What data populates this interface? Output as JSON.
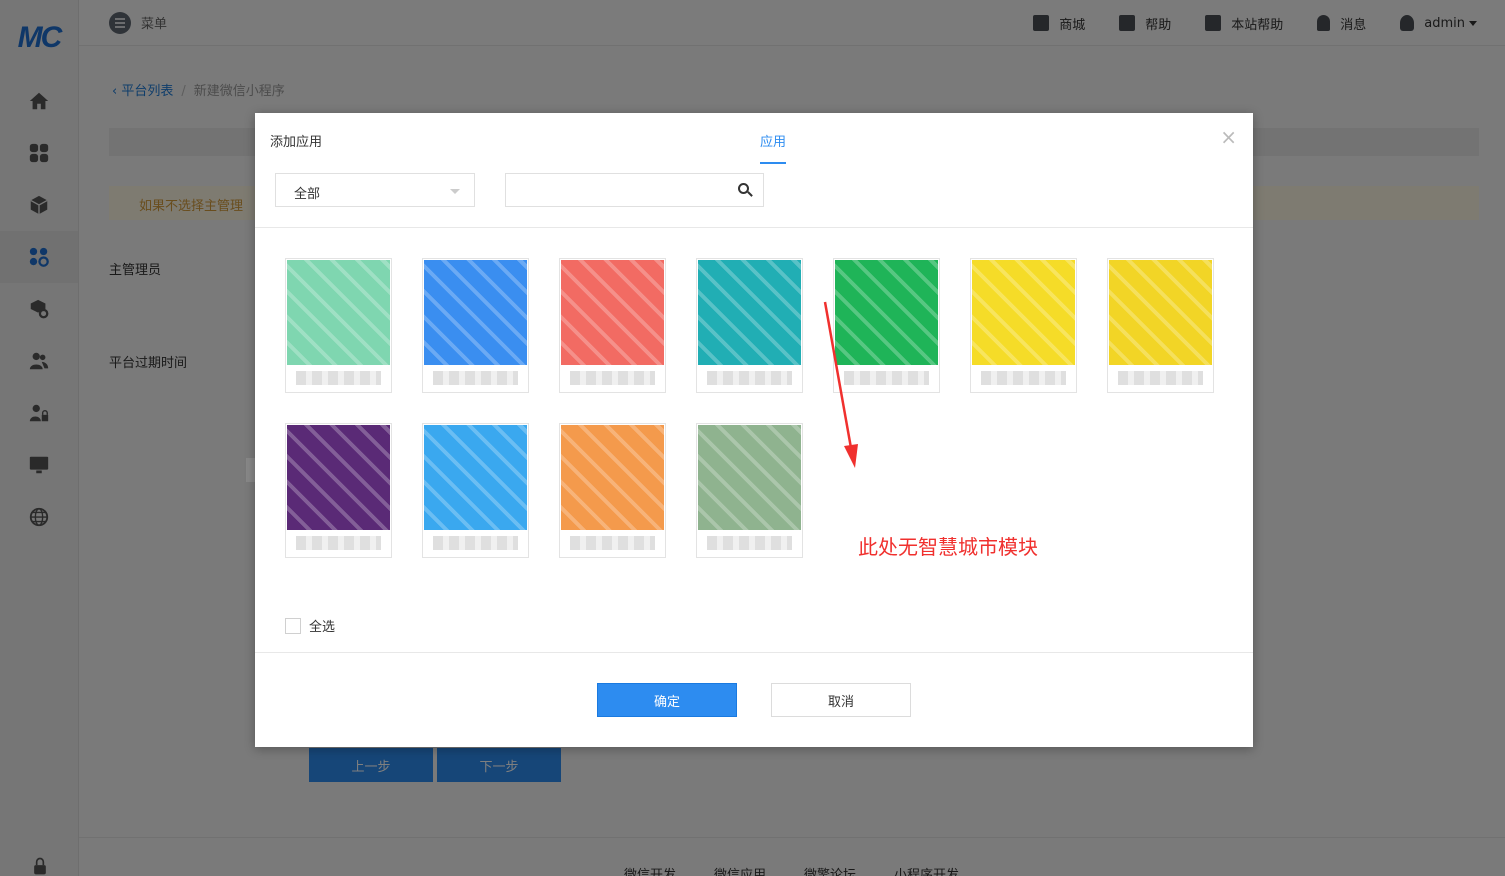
{
  "logo": "MC",
  "header": {
    "menu_label": "菜单",
    "links": [
      {
        "icon": "store-icon",
        "label": "商城"
      },
      {
        "icon": "help-icon",
        "label": "帮助"
      },
      {
        "icon": "site-help-icon",
        "label": "本站帮助"
      },
      {
        "icon": "bell-icon",
        "label": "消息"
      },
      {
        "icon": "user-icon",
        "label": "admin"
      }
    ]
  },
  "sidebar": {
    "items": [
      {
        "icon": "home-icon"
      },
      {
        "icon": "apps-grid-icon"
      },
      {
        "icon": "cube-icon"
      },
      {
        "icon": "apps-settings-icon",
        "active": true
      },
      {
        "icon": "package-settings-icon"
      },
      {
        "icon": "users-icon"
      },
      {
        "icon": "user-lock-icon"
      },
      {
        "icon": "monitor-icon"
      },
      {
        "icon": "globe-icon"
      }
    ]
  },
  "breadcrumb": {
    "back_label": "平台列表",
    "separator": "/",
    "current": "新建微信小程序"
  },
  "page": {
    "warning_text": "如果不选择主管理",
    "label_admin": "主管理员",
    "label_expire": "平台过期时间",
    "prev_step": "上一步",
    "next_step": "下一步"
  },
  "footer": {
    "links": [
      "微信开发",
      "微信应用",
      "微擎论坛",
      "小程序开发"
    ]
  },
  "modal": {
    "title": "添加应用",
    "tab": "应用",
    "close": "×",
    "filter_selected": "全部",
    "search_placeholder": "",
    "select_all_label": "全选",
    "confirm_label": "确定",
    "cancel_label": "取消",
    "annotation": "此处无智慧城市模块",
    "apps": [
      {
        "name": "",
        "color": "#7fd6b0"
      },
      {
        "name": "",
        "color": "#3a8ef0"
      },
      {
        "name": "",
        "color": "#f26b63"
      },
      {
        "name": "",
        "color": "#21aeb4"
      },
      {
        "name": "",
        "color": "#1fb458"
      },
      {
        "name": "",
        "color": "#f5dc28"
      },
      {
        "name": "",
        "color": "#f2d526"
      },
      {
        "name": "",
        "color": "#5a2a76"
      },
      {
        "name": "",
        "color": "#3aa8ef"
      },
      {
        "name": "",
        "color": "#f49a4c"
      },
      {
        "name": "",
        "color": "#8fb38f"
      }
    ]
  }
}
